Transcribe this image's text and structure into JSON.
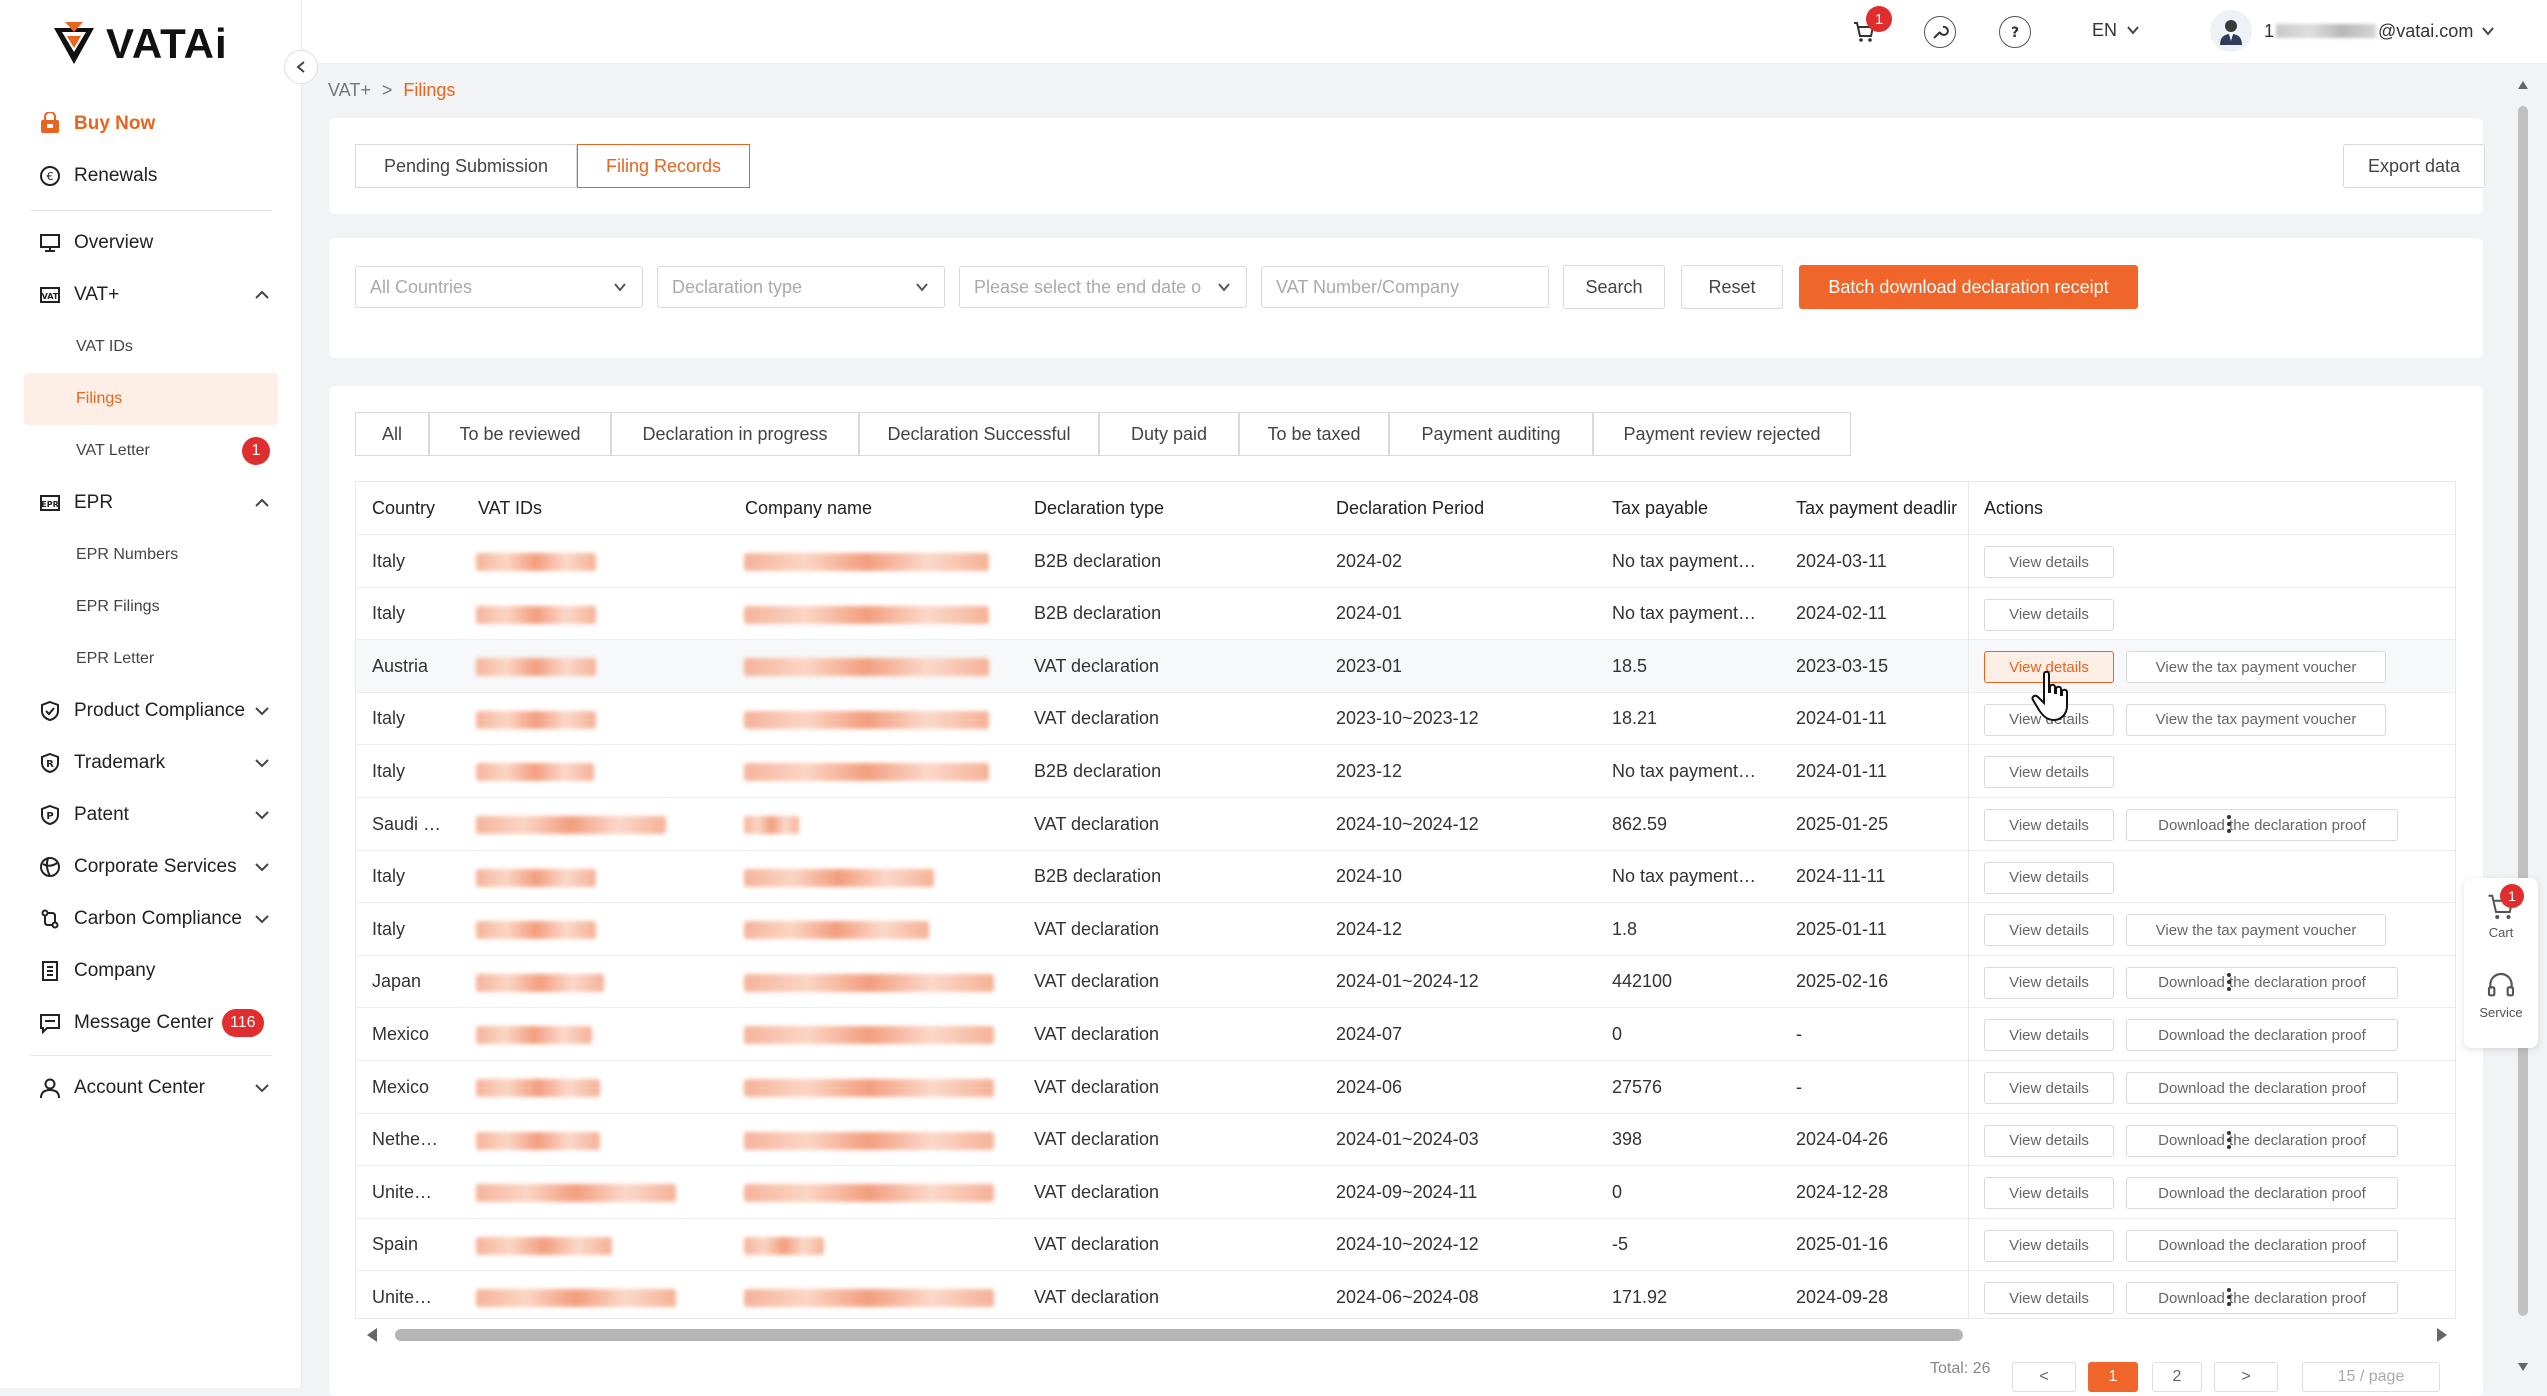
{
  "brand": {
    "name": "VATAi",
    "accent": "#e8641f"
  },
  "sidebar": {
    "buy_now": "Buy Now",
    "renewals": "Renewals",
    "overview": "Overview",
    "vat": {
      "label": "VAT+",
      "items": [
        "VAT IDs",
        "Filings",
        "VAT Letter"
      ],
      "letter_badge": "1"
    },
    "epr": {
      "label": "EPR",
      "items": [
        "EPR Numbers",
        "EPR Filings",
        "EPR Letter"
      ]
    },
    "product_compliance": "Product Compliance",
    "trademark": "Trademark",
    "patent": "Patent",
    "corporate_services": "Corporate Services",
    "carbon_compliance": "Carbon Compliance",
    "company": "Company",
    "message_center": "Message Center",
    "message_badge": "116",
    "account_center": "Account Center"
  },
  "topbar": {
    "cart_badge": "1",
    "language": "EN",
    "user_prefix": "1",
    "user_suffix": "@vatai.com"
  },
  "breadcrumb": {
    "root": "VAT+",
    "sep": ">",
    "current": "Filings"
  },
  "tabs": {
    "pending": "Pending Submission",
    "records": "Filing Records",
    "export": "Export data"
  },
  "filters": {
    "countries": "All Countries",
    "declaration_type": "Declaration type",
    "end_date": "Please select the end date o",
    "vat_number": "VAT Number/Company",
    "search": "Search",
    "reset": "Reset",
    "batch": "Batch download declaration receipt"
  },
  "status_tabs": [
    "All",
    "To be reviewed",
    "Declaration in progress",
    "Declaration Successful",
    "Duty paid",
    "To be taxed",
    "Payment auditing",
    "Payment review rejected"
  ],
  "table": {
    "headers": [
      "Country",
      "VAT IDs",
      "Company name",
      "Declaration type",
      "Declaration Period",
      "Tax payable",
      "Tax payment deadlir",
      "Actions"
    ],
    "view_label": "View details",
    "rows": [
      {
        "country": "Italy",
        "type": "B2B declaration",
        "period": "2024-02",
        "tax": "No tax payment…",
        "deadline": "2024-03-11",
        "second": "",
        "more": false
      },
      {
        "country": "Italy",
        "type": "B2B declaration",
        "period": "2024-01",
        "tax": "No tax payment…",
        "deadline": "2024-02-11",
        "second": "",
        "more": false
      },
      {
        "country": "Austria",
        "type": "VAT declaration",
        "period": "2023-01",
        "tax": "18.5",
        "deadline": "2023-03-15",
        "second": "View the tax payment voucher",
        "more": false
      },
      {
        "country": "Italy",
        "type": "VAT declaration",
        "period": "2023-10~2023-12",
        "tax": "18.21",
        "deadline": "2024-01-11",
        "second": "View the tax payment voucher",
        "more": false
      },
      {
        "country": "Italy",
        "type": "B2B declaration",
        "period": "2023-12",
        "tax": "No tax payment…",
        "deadline": "2024-01-11",
        "second": "",
        "more": false
      },
      {
        "country": "Saudi …",
        "type": "VAT declaration",
        "period": "2024-10~2024-12",
        "tax": "862.59",
        "deadline": "2025-01-25",
        "second": "Download the declaration proof",
        "more": true
      },
      {
        "country": "Italy",
        "type": "B2B declaration",
        "period": "2024-10",
        "tax": "No tax payment…",
        "deadline": "2024-11-11",
        "second": "",
        "more": false
      },
      {
        "country": "Italy",
        "type": "VAT declaration",
        "period": "2024-12",
        "tax": "1.8",
        "deadline": "2025-01-11",
        "second": "View the tax payment voucher",
        "more": false
      },
      {
        "country": "Japan",
        "type": "VAT declaration",
        "period": "2024-01~2024-12",
        "tax": "442100",
        "deadline": "2025-02-16",
        "second": "Download the declaration proof",
        "more": true
      },
      {
        "country": "Mexico",
        "type": "VAT declaration",
        "period": "2024-07",
        "tax": "0",
        "deadline": "-",
        "second": "Download the declaration proof",
        "more": false
      },
      {
        "country": "Mexico",
        "type": "VAT declaration",
        "period": "2024-06",
        "tax": "27576",
        "deadline": "-",
        "second": "Download the declaration proof",
        "more": false
      },
      {
        "country": "Nethe…",
        "type": "VAT declaration",
        "period": "2024-01~2024-03",
        "tax": "398",
        "deadline": "2024-04-26",
        "second": "Download the declaration proof",
        "more": true
      },
      {
        "country": "Unite…",
        "type": "VAT declaration",
        "period": "2024-09~2024-11",
        "tax": "0",
        "deadline": "2024-12-28",
        "second": "Download the declaration proof",
        "more": false
      },
      {
        "country": "Spain",
        "type": "VAT declaration",
        "period": "2024-10~2024-12",
        "tax": "-5",
        "deadline": "2025-01-16",
        "second": "Download the declaration proof",
        "more": false
      },
      {
        "country": "Unite…",
        "type": "VAT declaration",
        "period": "2024-06~2024-08",
        "tax": "171.92",
        "deadline": "2024-09-28",
        "second": "Download the declaration proof",
        "more": true
      }
    ]
  },
  "pagination": {
    "total": "Total: 26",
    "prev": "<",
    "pages": [
      "1",
      "2"
    ],
    "next": ">",
    "page_size": "15 / page"
  },
  "float": {
    "cart": "Cart",
    "cart_badge": "1",
    "service": "Service"
  }
}
